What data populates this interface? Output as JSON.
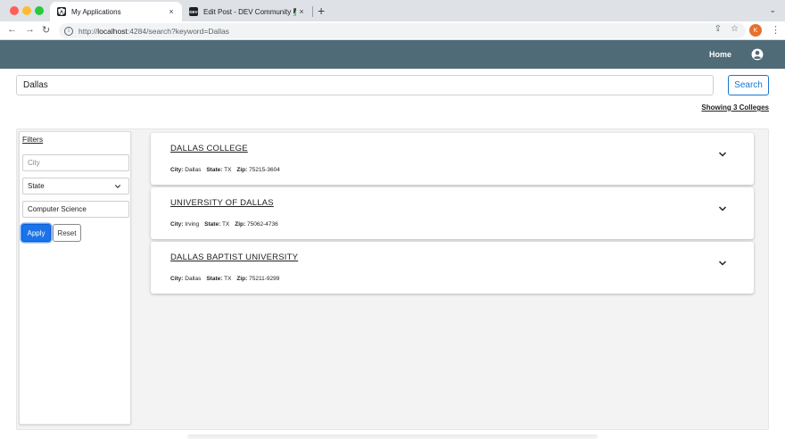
{
  "browser": {
    "tabs": [
      {
        "title": "My Applications",
        "favicon": "angular-logo-icon",
        "active": true
      },
      {
        "title": "Edit Post - DEV Community 👩‍💻👨‍💻",
        "favicon": "dev-logo-icon",
        "favicon_text": "DEV",
        "active": false
      }
    ],
    "tab_close_glyph": "×",
    "new_tab_glyph": "+",
    "tab_menu_glyph": "⌄",
    "url_prefix": "http://",
    "url_host": "localhost",
    "url_rest": ":4284/search?keyword=Dallas",
    "profile_initial": "K"
  },
  "header": {
    "home_label": "Home",
    "account_icon": "account-circle-icon",
    "background": "#4f6b78"
  },
  "search": {
    "value": "Dallas",
    "button_label": "Search"
  },
  "results_count_label": "Showing 3 Colleges",
  "filters": {
    "title": "Filters",
    "city_placeholder": "City",
    "state_value": "State",
    "course_value": "Computer Science",
    "apply_label": "Apply",
    "reset_label": "Reset"
  },
  "colleges": [
    {
      "name": "DALLAS COLLEGE",
      "city_label": "City:",
      "city": "Dallas",
      "state_label": "State:",
      "state": "TX",
      "zip_label": "Zip:",
      "zip": "75215-3604"
    },
    {
      "name": "UNIVERSITY OF DALLAS",
      "city_label": "City:",
      "city": "Irving",
      "state_label": "State:",
      "state": "TX",
      "zip_label": "Zip:",
      "zip": "75062-4736"
    },
    {
      "name": "DALLAS BAPTIST UNIVERSITY",
      "city_label": "City:",
      "city": "Dallas",
      "state_label": "State:",
      "state": "TX",
      "zip_label": "Zip:",
      "zip": "75211-9299"
    }
  ],
  "colors": {
    "accent": "#1a73e8",
    "search_button": "#1976d2",
    "header_bg": "#4f6b78"
  }
}
